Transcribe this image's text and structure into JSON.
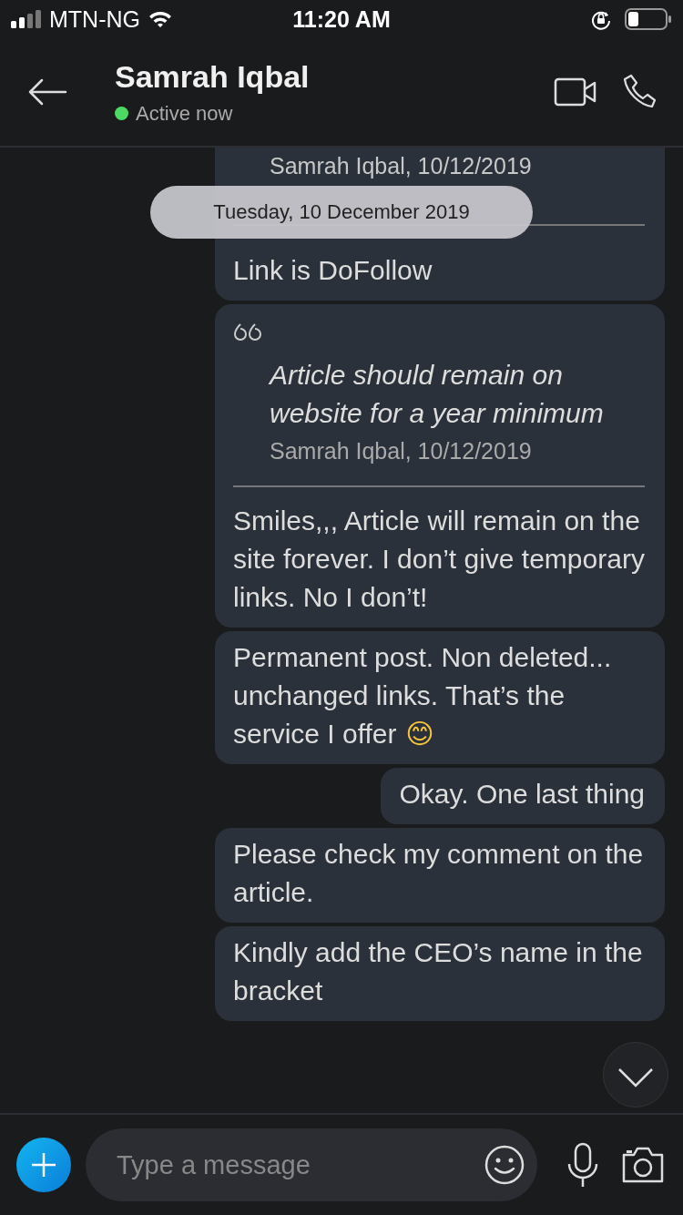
{
  "status_bar": {
    "carrier": "MTN-NG",
    "time": "11:20 AM"
  },
  "header": {
    "name": "Samrah Iqbal",
    "status": "Active now",
    "online": true
  },
  "date_pill": "Tuesday, 10 December 2019",
  "messages": [
    {
      "kind": "quote",
      "quote_author": "Samrah Iqbal, 10/12/2019",
      "text": "Link is DoFollow"
    },
    {
      "kind": "quote",
      "quote_text": "Article should remain on website for a year minimum",
      "quote_author": "Samrah Iqbal, 10/12/2019",
      "text": "Smiles,,, Article will remain on the site forever. I don’t give temporary links. No I don’t!"
    },
    {
      "kind": "text",
      "text": "Permanent post. Non deleted... unchanged links. That’s the service I offer",
      "emoji": "😊"
    },
    {
      "kind": "text",
      "text": "Okay. One last thing"
    },
    {
      "kind": "text",
      "text": "Please check my comment on the article."
    },
    {
      "kind": "text",
      "text": "Kindly add the CEO’s name in the bracket"
    }
  ],
  "composer": {
    "placeholder": "Type a message"
  }
}
